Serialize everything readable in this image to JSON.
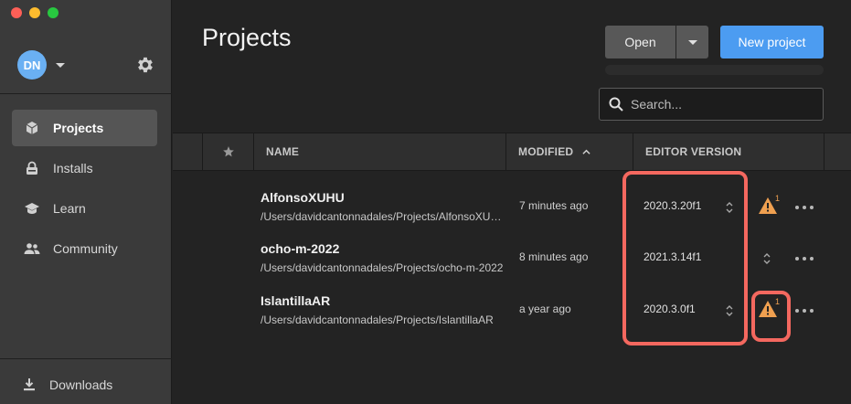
{
  "sidebar": {
    "avatar_initials": "DN",
    "nav": [
      {
        "label": "Projects",
        "icon": "cube-icon",
        "active": true
      },
      {
        "label": "Installs",
        "icon": "lock-icon",
        "active": false
      },
      {
        "label": "Learn",
        "icon": "graduation-cap-icon",
        "active": false
      },
      {
        "label": "Community",
        "icon": "people-icon",
        "active": false
      }
    ],
    "downloads_label": "Downloads"
  },
  "header": {
    "title": "Projects",
    "open_label": "Open",
    "new_project_label": "New project"
  },
  "search": {
    "placeholder": "Search..."
  },
  "table": {
    "columns": {
      "name": "NAME",
      "modified": "MODIFIED",
      "editor_version": "EDITOR VERSION"
    },
    "rows": [
      {
        "name": "AlfonsoXUHU",
        "path": "/Users/davidcantonnadales/Projects/AlfonsoXUHU",
        "modified": "7 minutes ago",
        "version": "2020.3.20f1",
        "warning": "1"
      },
      {
        "name": "ocho-m-2022",
        "path": "/Users/davidcantonnadales/Projects/ocho-m-2022",
        "modified": "8 minutes ago",
        "version": "2021.3.14f1",
        "warning": null
      },
      {
        "name": "IslantillaAR",
        "path": "/Users/davidcantonnadales/Projects/IslantillaAR",
        "modified": "a year ago",
        "version": "2020.3.0f1",
        "warning": "1"
      }
    ]
  },
  "colors": {
    "accent": "#4c9cf1",
    "highlight": "#f4685f",
    "warning": "#f0a050"
  }
}
